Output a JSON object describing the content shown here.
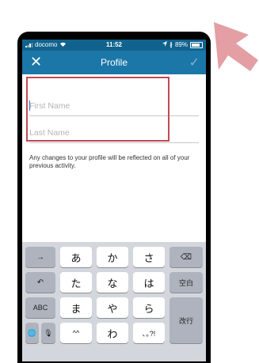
{
  "status_bar": {
    "carrier": "docomo",
    "time": "11:52",
    "battery": "89%"
  },
  "nav": {
    "close_glyph": "✕",
    "title": "Profile",
    "check_glyph": "✓"
  },
  "form": {
    "first_name": {
      "placeholder": "First Name",
      "value": ""
    },
    "last_name": {
      "placeholder": "Last Name",
      "value": ""
    },
    "note": "Any changes to your profile will be reflected on all of your previous activity."
  },
  "keyboard": {
    "row1": [
      "→",
      "あ",
      "か",
      "さ",
      "⌫"
    ],
    "row2": [
      "↶",
      "た",
      "な",
      "は",
      "空白"
    ],
    "row3": [
      "ABC",
      "ま",
      "や",
      "ら"
    ],
    "row4": [
      "🌐",
      "🎙",
      "^^",
      "わ",
      "､｡?!"
    ],
    "enter": "改行"
  },
  "colors": {
    "nav_bar": "#1a77a8",
    "highlight_box": "#c24a54",
    "arrow": "#e29a9e"
  }
}
